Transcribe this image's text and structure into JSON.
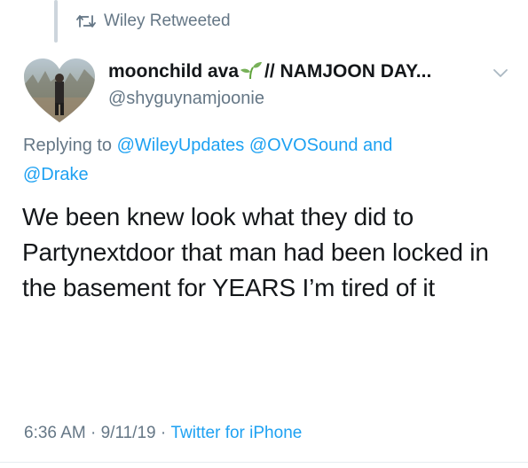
{
  "retweet": {
    "label": "Wiley Retweeted",
    "icon": "retweet-icon"
  },
  "author": {
    "name": "moonchild ava",
    "name_suffix": "// NAMJOON DAY...",
    "handle": "@shyguynamjoonie",
    "emoji_icon": "sprout-icon"
  },
  "reply": {
    "prefix": "Replying to",
    "mention1": "@WileyUpdates",
    "mention2": "@OVOSound",
    "conjunction": "and",
    "mention3": "@Drake"
  },
  "tweet": {
    "text": "We been knew look what they did to Partynextdoor that man had been locked in the basement for YEARS I’m tired of it"
  },
  "meta": {
    "time": "6:36 AM",
    "sep1": " · ",
    "date": "9/11/19",
    "sep2": " · ",
    "source": "Twitter for iPhone"
  },
  "colors": {
    "link": "#1da1f2",
    "secondary": "#657786",
    "text": "#14171a"
  }
}
